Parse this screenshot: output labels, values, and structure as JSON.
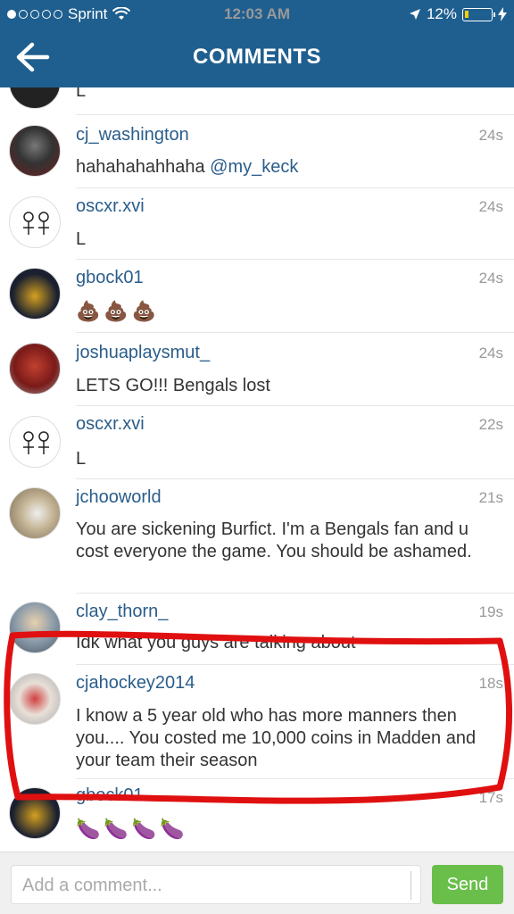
{
  "status": {
    "carrier": "Sprint",
    "time": "12:03 AM",
    "battery": "12%"
  },
  "header": {
    "title": "COMMENTS"
  },
  "comments": [
    {
      "username": "",
      "time": "",
      "text": "L"
    },
    {
      "username": "cj_washington",
      "time": "24s",
      "text": "hahahahahhaha ",
      "mention": "@my_keck"
    },
    {
      "username": "oscxr.xvi",
      "time": "24s",
      "text": "L"
    },
    {
      "username": "gbock01",
      "time": "24s",
      "text": "💩💩💩"
    },
    {
      "username": "joshuaplaysmut_",
      "time": "24s",
      "text": "LETS GO!!! Bengals lost"
    },
    {
      "username": "oscxr.xvi",
      "time": "22s",
      "text": "L"
    },
    {
      "username": "jchooworld",
      "time": "21s",
      "text": "You are sickening Burfict. I'm a Bengals fan and u cost everyone the game. You should be ashamed."
    },
    {
      "username": "clay_thorn_",
      "time": "19s",
      "text": "Idk what you guys are talking about"
    },
    {
      "username": "cjahockey2014",
      "time": "18s",
      "text": "I know a 5 year old who has more manners then you.... You costed me 10,000 coins in Madden and your team their season"
    },
    {
      "username": "gbock01",
      "time": "17s",
      "text": "🍆🍆🍆🍆"
    }
  ],
  "composer": {
    "placeholder": "Add a comment...",
    "send_label": "Send"
  }
}
